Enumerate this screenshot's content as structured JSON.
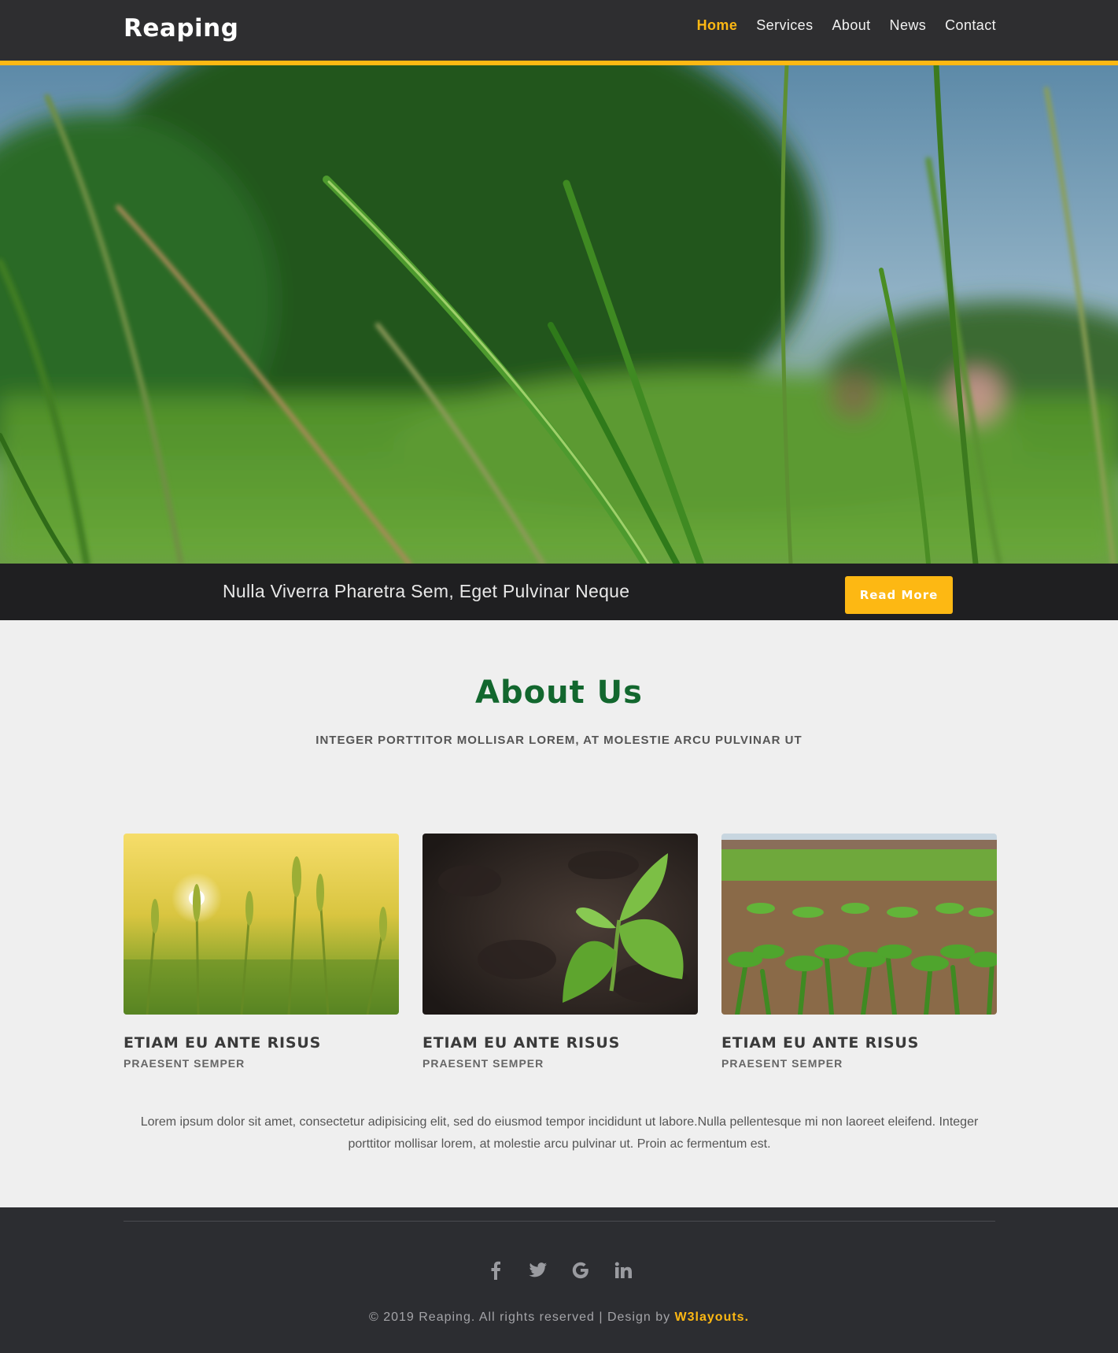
{
  "header": {
    "logo": "Reaping",
    "nav": [
      {
        "label": "Home",
        "active": true
      },
      {
        "label": "Services",
        "active": false
      },
      {
        "label": "About",
        "active": false
      },
      {
        "label": "News",
        "active": false
      },
      {
        "label": "Contact",
        "active": false
      }
    ]
  },
  "banner": {
    "text": "Nulla Viverra Pharetra Sem, Eget Pulvinar Neque",
    "button_label": "Read More"
  },
  "about": {
    "title": "About Us",
    "subtitle": "INTEGER PORTTITOR MOLLISAR LOREM, AT MOLESTIE ARCU PULVINAR UT",
    "cards": [
      {
        "title": "ETIAM EU ANTE RISUS",
        "subtitle": "PRAESENT SEMPER"
      },
      {
        "title": "ETIAM EU ANTE RISUS",
        "subtitle": "PRAESENT SEMPER"
      },
      {
        "title": "ETIAM EU ANTE RISUS",
        "subtitle": "PRAESENT SEMPER"
      }
    ],
    "text": "Lorem ipsum dolor sit amet, consectetur adipisicing elit, sed do eiusmod tempor incididunt ut labore.Nulla pellentesque mi non laoreet eleifend. Integer porttitor mollisar lorem, at molestie arcu pulvinar ut. Proin ac fermentum est."
  },
  "footer": {
    "socials": [
      "facebook-icon",
      "twitter-icon",
      "google-icon",
      "linkedin-icon"
    ],
    "copyright": "© 2019 Reaping. All rights reserved | Design by ",
    "credit_link": "W3layouts."
  },
  "colors": {
    "accent": "#fdb813",
    "heading_green": "#12672e",
    "header_bg": "#2e2e30",
    "footer_bg": "#2c2d31",
    "page_bg": "#efefef"
  }
}
